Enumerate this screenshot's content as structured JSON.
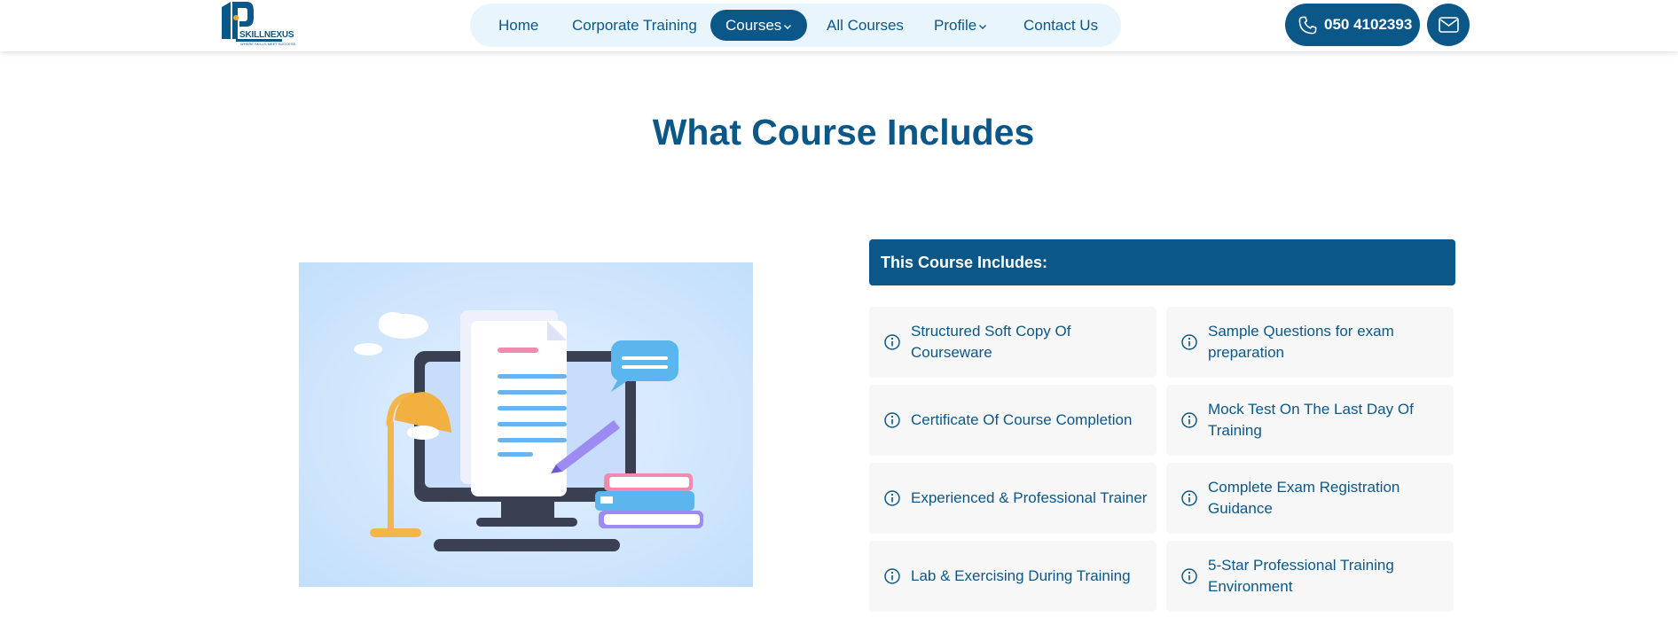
{
  "header": {
    "logo": {
      "brand": "SKILLNEXUS",
      "tagline": "WHERE SKILLS MEET SUCCESS"
    },
    "nav": [
      {
        "label": "Home"
      },
      {
        "label": "Corporate Training"
      },
      {
        "label": "Courses"
      },
      {
        "label": "All Courses"
      },
      {
        "label": "Profile"
      },
      {
        "label": "Contact Us"
      }
    ],
    "phone": "050 4102393"
  },
  "section": {
    "title": "What Course Includes",
    "includes_heading": "This Course Includes:",
    "items": [
      {
        "label": "Structured Soft Copy Of Courseware"
      },
      {
        "label": "Sample Questions for exam preparation"
      },
      {
        "label": "Certificate Of Course Completion"
      },
      {
        "label": "Mock Test On The Last Day Of Training"
      },
      {
        "label": "Experienced & Professional Trainer"
      },
      {
        "label": "Complete Exam Registration Guidance"
      },
      {
        "label": "Lab & Exercising During Training"
      },
      {
        "label": "5-Star Professional Training Environment"
      }
    ]
  },
  "colors": {
    "brand": "#0b5788",
    "nav_bg": "#e8f5fc",
    "card_bg": "#f7f7f7"
  },
  "icons": [
    "phone-icon",
    "mail-icon",
    "info-icon",
    "chevron-down-icon"
  ]
}
